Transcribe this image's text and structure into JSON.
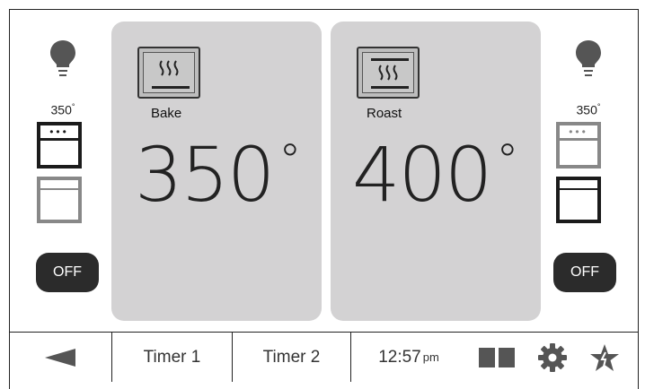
{
  "left_oven": {
    "temp_value": "350",
    "temp_unit": "°",
    "off_label": "OFF"
  },
  "right_oven": {
    "temp_value": "350",
    "temp_unit": "°",
    "off_label": "OFF"
  },
  "panels": [
    {
      "mode": "Bake",
      "temperature": "350",
      "unit": "°"
    },
    {
      "mode": "Roast",
      "temperature": "400",
      "unit": "°"
    }
  ],
  "bottom_bar": {
    "timer1": "Timer 1",
    "timer2": "Timer 2",
    "time": "12:57",
    "time_suffix": "pm"
  },
  "icons": {
    "back": "back-arrow-icon",
    "light": "light-bulb-icon",
    "dual": "dual-panel-icon",
    "settings": "gear-icon",
    "favorites": "star-icon"
  },
  "colors": {
    "panel": "#d3d2d3",
    "off_button": "#2b2b2b",
    "active_outline": "#1b1b1b",
    "inactive_outline": "#888888"
  }
}
